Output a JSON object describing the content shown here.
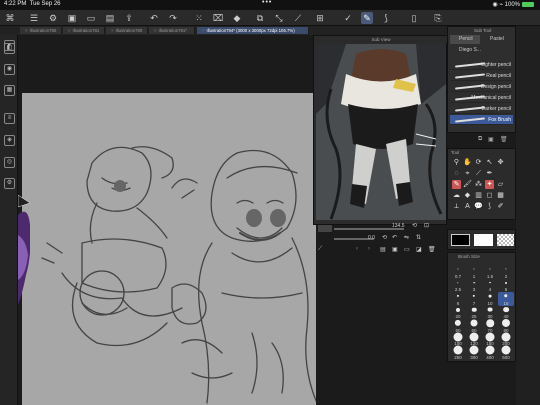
{
  "status_bar": {
    "time": "4:22 PM",
    "date": "Tue Sep 26",
    "battery": "100%"
  },
  "tabs": [
    {
      "label": "Illustration780"
    },
    {
      "label": "Illustration781"
    },
    {
      "label": "Illustration780"
    },
    {
      "label": "Illustration781*"
    },
    {
      "label": "Illustration794* (3000 x 3000px 72dpi 106.7%)"
    }
  ],
  "subview": {
    "title": "Sub View",
    "zoom": "134.5",
    "rotation": "0.0"
  },
  "subtool": {
    "title": "Sub Tool",
    "tabs": [
      "Pencil",
      "Pastel"
    ],
    "group": "Diego S...",
    "items": [
      {
        "label": "Lighter pencil"
      },
      {
        "label": "Real pencil"
      },
      {
        "label": "Design pencil"
      },
      {
        "label": "Mechanical pencil"
      },
      {
        "label": "Darker pencil"
      },
      {
        "label": "Fox Brush"
      }
    ],
    "selected_index": 5
  },
  "tool_panel": {
    "title": "Tool"
  },
  "brush_size": {
    "title": "Brush Size",
    "sizes": [
      "0.7",
      "1",
      "1.5",
      "2",
      "2.5",
      "3",
      "4",
      "5",
      "6",
      "7",
      "10",
      "15",
      "20",
      "25",
      "30",
      "40",
      "50",
      "60",
      "70",
      "80",
      "100",
      "120",
      "150",
      "200",
      "250",
      "300",
      "400",
      "500"
    ],
    "selected": "15"
  },
  "colors": {
    "main": "#000000",
    "sub": "#ffffff"
  }
}
